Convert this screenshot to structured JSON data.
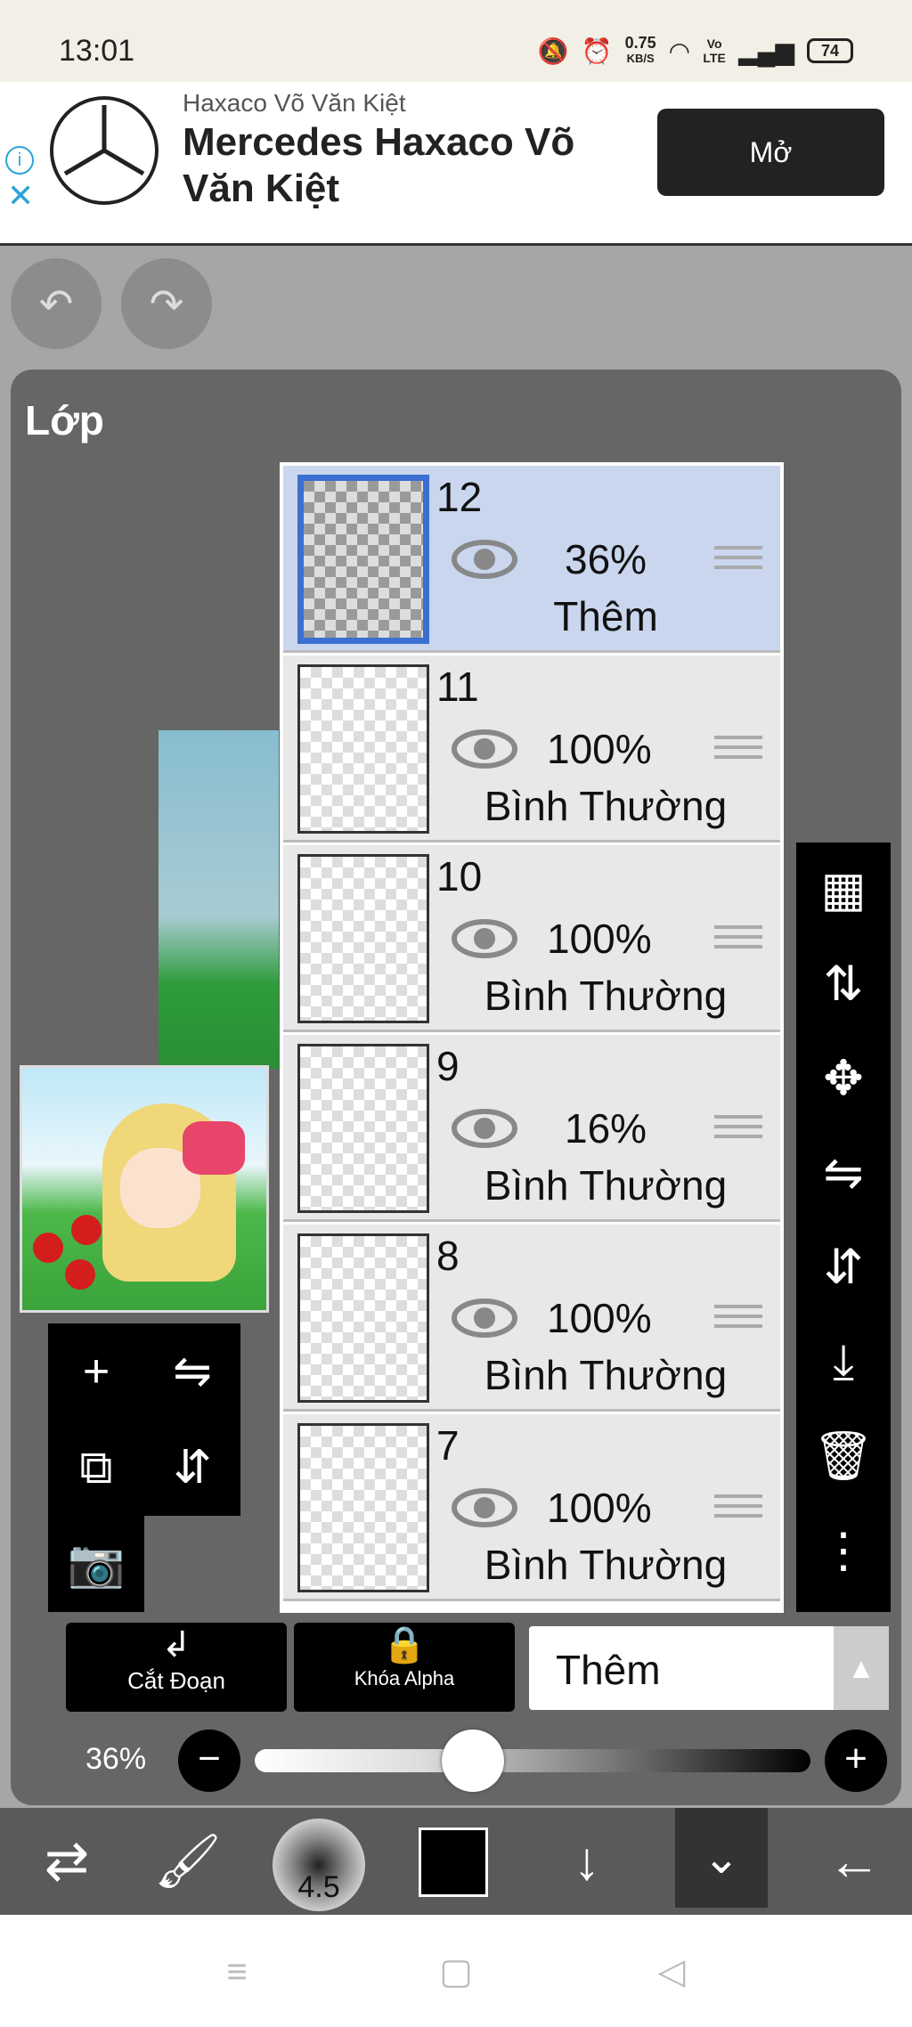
{
  "status_bar": {
    "time": "13:01",
    "net_speed_value": "0.75",
    "net_speed_unit": "KB/S",
    "volte": "Vo LTE",
    "battery": "74"
  },
  "ad": {
    "sponsor": "Haxaco Võ Văn Kiệt",
    "headline": "Mercedes Haxaco Võ Văn Kiệt",
    "open_label": "Mở"
  },
  "panel": {
    "title": "Lớp"
  },
  "layers": [
    {
      "number": "12",
      "opacity": "36%",
      "blend": "Thêm",
      "selected": true
    },
    {
      "number": "11",
      "opacity": "100%",
      "blend": "Bình Thường",
      "selected": false
    },
    {
      "number": "10",
      "opacity": "100%",
      "blend": "Bình Thường",
      "selected": false
    },
    {
      "number": "9",
      "opacity": "16%",
      "blend": "Bình Thường",
      "selected": false
    },
    {
      "number": "8",
      "opacity": "100%",
      "blend": "Bình Thường",
      "selected": false
    },
    {
      "number": "7",
      "opacity": "100%",
      "blend": "Bình Thường",
      "selected": false
    }
  ],
  "controls": {
    "clip_label": "Cắt Đoạn",
    "alpha_lock_label": "Khóa Alpha",
    "blend_mode": "Thêm",
    "opacity_label": "36%",
    "opacity_value": 0.36
  },
  "bottom_bar": {
    "brush_size": "4.5",
    "color": "#000000"
  },
  "colors": {
    "selected_layer_bg": "#c9d6ee",
    "selected_border": "#3b6fd1",
    "panel_bg": "#666666"
  }
}
